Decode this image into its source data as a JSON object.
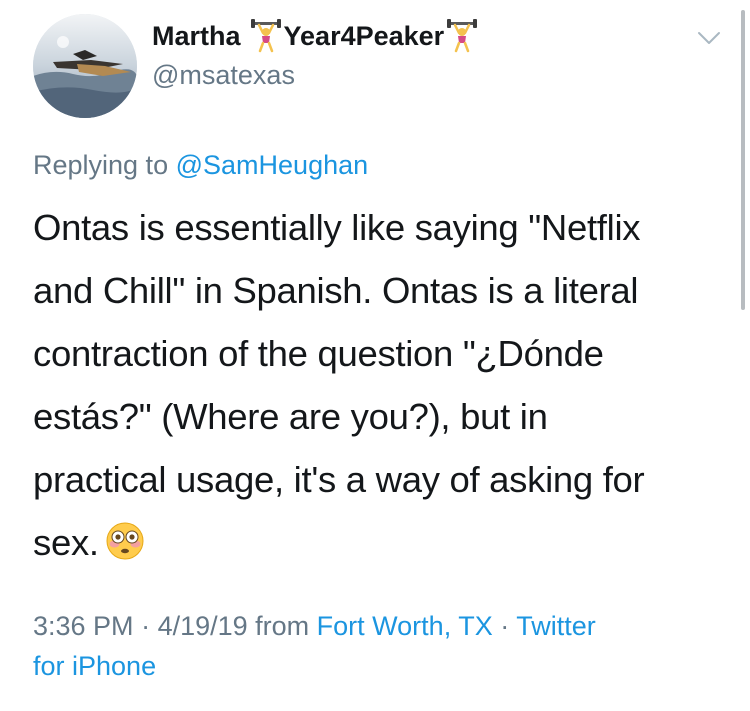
{
  "tweet": {
    "author": {
      "display_name_first": "Martha",
      "display_name_second": "Year4Peaker",
      "handle": "@msatexas",
      "name_emoji": "weightlifter-emoji"
    },
    "reply": {
      "prefix": "Replying to",
      "mention": "@SamHeughan"
    },
    "body_lines": [
      "Ontas is essentially like saying \"Netflix",
      "and Chill\" in Spanish. Ontas is a literal",
      "contraction of the question \"¿Dónde",
      "estás?\" (Where are you?), but in",
      "practical usage, it's a way of asking for",
      "sex."
    ],
    "body_emoji": "flushed-face-emoji",
    "meta": {
      "time": "3:36 PM",
      "sep1": " · ",
      "date": "4/19/19",
      "from_word": " from ",
      "location": "Fort Worth, TX",
      "sep2": " · ",
      "client_part1": "Twitter",
      "client_part2": "for iPhone"
    }
  },
  "colors": {
    "text": "#14171a",
    "secondary": "#657786",
    "link": "#1b95e0"
  }
}
